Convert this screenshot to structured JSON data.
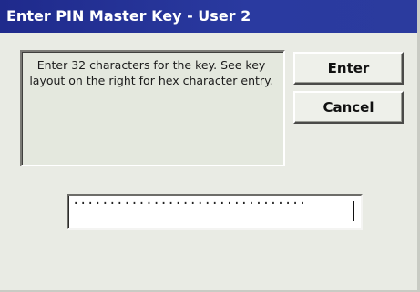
{
  "window": {
    "title": "Enter PIN Master Key - User 2"
  },
  "message": {
    "text": "Enter 32 characters for the key. See key layout on the right for hex character entry."
  },
  "buttons": {
    "enter_label": "Enter",
    "cancel_label": "Cancel"
  },
  "pin_field": {
    "value": "································"
  },
  "colors": {
    "titlebar": "#25339a",
    "window_bg": "#e9ebe4",
    "field_bg": "#ffffff"
  }
}
